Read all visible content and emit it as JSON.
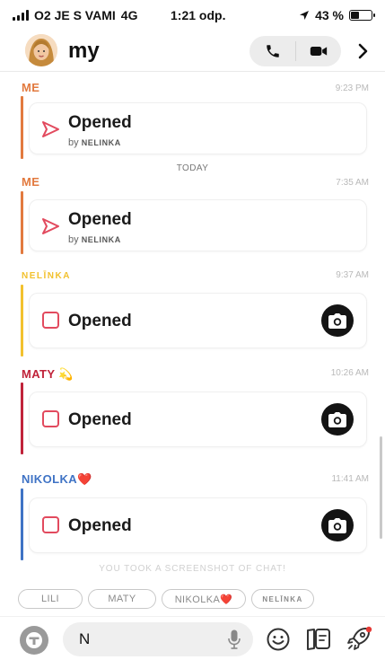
{
  "status_bar": {
    "carrier": "O2 JE S VAMI",
    "network": "4G",
    "time": "1:21 odp.",
    "battery_text": "43 %",
    "battery_level": 0.43
  },
  "header": {
    "title": "my"
  },
  "messages": [
    {
      "sender": "ME",
      "time": "9:23 PM",
      "color": "#e27a3f",
      "status": "Opened",
      "by_prefix": "by",
      "by_name": "NELINKA",
      "kind": "sent"
    },
    {
      "sender": "ME",
      "time": "7:35 AM",
      "color": "#e27a3f",
      "status": "Opened",
      "by_prefix": "by",
      "by_name": "NELINKA",
      "kind": "sent"
    },
    {
      "sender": "NELĪNKA",
      "time": "9:37 AM",
      "color": "#f2c12e",
      "status": "Opened",
      "kind": "received"
    },
    {
      "sender": "MATY",
      "sender_emoji": "💫",
      "time": "10:26 AM",
      "color": "#c0233a",
      "status": "Opened",
      "kind": "received"
    },
    {
      "sender": "NIKOLKA",
      "sender_emoji": "❤️",
      "time": "11:41 AM",
      "color": "#3f73c5",
      "status": "Opened",
      "kind": "received"
    }
  ],
  "divider": {
    "today": "TODAY"
  },
  "notice": "YOU TOOK A SCREENSHOT OF CHAT!",
  "chips": [
    {
      "label": "LILI"
    },
    {
      "label": "MATY"
    },
    {
      "label": "NIKOLKA❤️"
    },
    {
      "label": "NELĪNKA"
    }
  ],
  "composer": {
    "value": "N"
  },
  "colors": {
    "accent_red": "#e24a5e",
    "header_bg": "#ececec"
  },
  "icons": [
    "signal-icon",
    "location-arrow-icon",
    "battery-icon",
    "bitmoji-avatar",
    "phone-icon",
    "video-camera-icon",
    "chevron-right-icon",
    "sent-arrow-icon",
    "snap-square-icon",
    "camera-icon",
    "bitmoji-icon",
    "microphone-icon",
    "smiley-icon",
    "sticker-icon",
    "rocket-icon"
  ]
}
